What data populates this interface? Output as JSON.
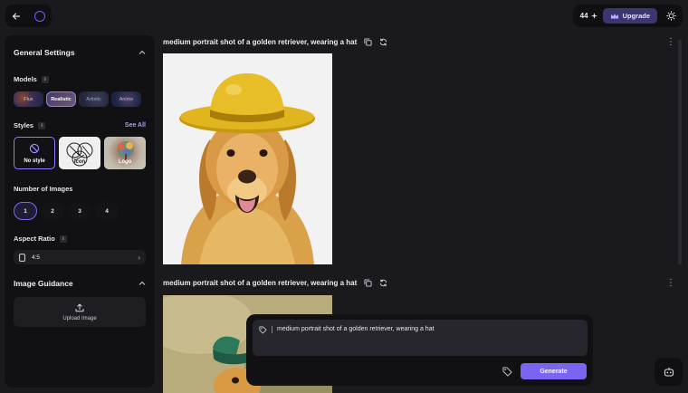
{
  "header": {
    "credits": "44",
    "upgrade_label": "Upgrade"
  },
  "sidebar": {
    "general_title": "General Settings",
    "models_label": "Models",
    "models": [
      "Flux",
      "Realistic",
      "Artistic",
      "Anime"
    ],
    "selected_model": "Realistic",
    "styles_label": "Styles",
    "see_all": "See All",
    "styles": [
      "No style",
      "Icon",
      "Logo"
    ],
    "num_images_label": "Number of Images",
    "num_images": [
      "1",
      "2",
      "3",
      "4"
    ],
    "selected_num": "1",
    "aspect_label": "Aspect Ratio",
    "aspect_value": "4:5",
    "guidance_title": "Image Guidance",
    "upload_label": "Upload Image"
  },
  "results": [
    {
      "prompt": "medium portrait shot of a golden retriever, wearing a hat"
    },
    {
      "prompt": "medium portrait shot of a golden retriever, wearing a hat"
    }
  ],
  "composer": {
    "prompt_text": "medium portrait shot of a golden retriever, wearing a hat",
    "generate_label": "Generate"
  },
  "colors": {
    "accent": "#7a64f0",
    "background": "#1a1a1e",
    "panel": "#111114"
  }
}
